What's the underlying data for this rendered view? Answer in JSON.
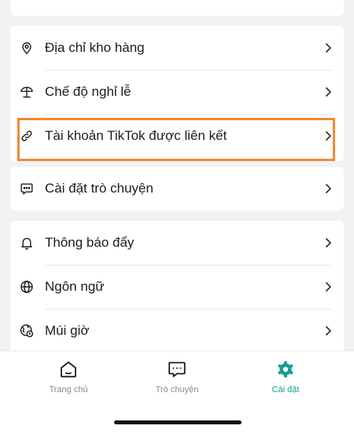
{
  "settings_group_1": {
    "items": [
      {
        "label": "Địa chỉ kho hàng",
        "icon": "location-pin-icon"
      },
      {
        "label": "Chế độ nghỉ lễ",
        "icon": "beach-umbrella-icon"
      },
      {
        "label": "Tài khoản TikTok được liên kết",
        "icon": "link-icon"
      }
    ]
  },
  "settings_group_2": {
    "items": [
      {
        "label": "Cài đặt trò chuyện",
        "icon": "chat-bubble-icon"
      }
    ]
  },
  "settings_group_3": {
    "items": [
      {
        "label": "Thông báo đẩy",
        "icon": "bell-icon"
      },
      {
        "label": "Ngôn ngữ",
        "icon": "globe-icon"
      },
      {
        "label": "Múi giờ",
        "icon": "timezone-globe-icon"
      }
    ]
  },
  "highlight": {
    "color": "#ef8a34"
  },
  "tabbar": {
    "tabs": [
      {
        "label": "Trang chủ",
        "icon": "home-icon",
        "active": false
      },
      {
        "label": "Trò chuyện",
        "icon": "chat-icon",
        "active": false
      },
      {
        "label": "Cài đặt",
        "icon": "gear-icon",
        "active": true
      }
    ],
    "active_color": "#1a9c93",
    "inactive_color": "#8a8a8e"
  }
}
